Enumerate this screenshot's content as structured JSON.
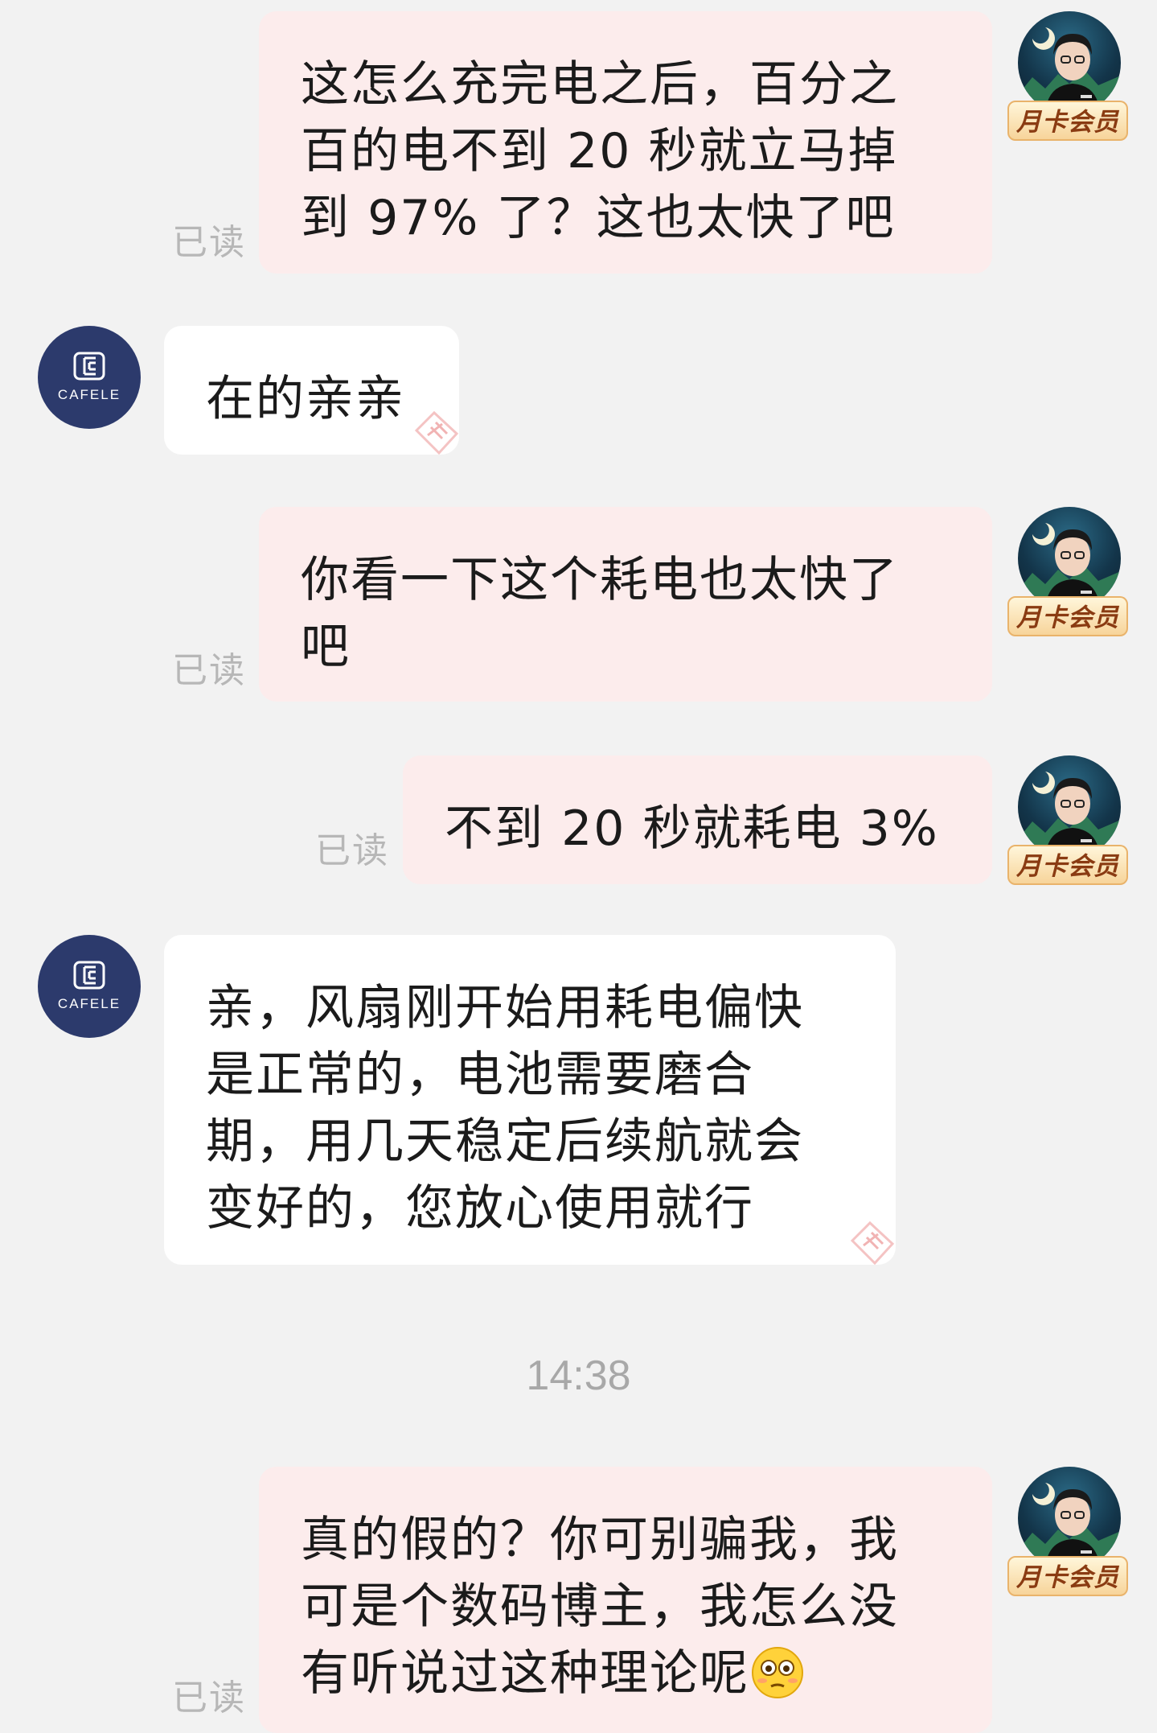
{
  "conversation": {
    "badge_label": "月卡会员",
    "shop_name": "CAFELE",
    "read_label": "已读",
    "messages": [
      {
        "from": "me",
        "lines": [
          "这怎么充完电之后，百分之",
          "百的电不到 20 秒就立马掉",
          "到 97% 了？这也太快了吧"
        ]
      },
      {
        "from": "shop",
        "lines": [
          "在的亲亲"
        ]
      },
      {
        "from": "me",
        "lines": [
          "你看一下这个耗电也太快了",
          "吧"
        ]
      },
      {
        "from": "me",
        "lines": [
          "不到 20 秒就耗电 3%"
        ]
      },
      {
        "from": "shop",
        "lines": [
          "亲，风扇刚开始用耗电偏快",
          "是正常的，电池需要磨合",
          "期，用几天稳定后续航就会",
          "变好的，您放心使用就行"
        ]
      },
      {
        "from": "me",
        "lines": [
          "真的假的？你可别骗我，我",
          "可是个数码博主，我怎么没",
          "有听说过这种理论呢"
        ]
      }
    ],
    "timestamp": "14:38",
    "emoji_name": "flushed-face-emoji"
  }
}
